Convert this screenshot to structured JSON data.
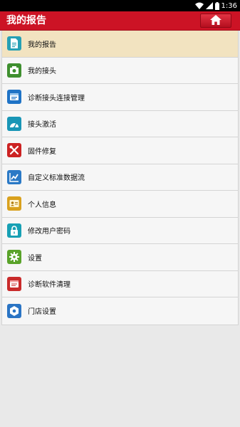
{
  "status_bar": {
    "time": "1:36"
  },
  "header": {
    "title": "我的报告",
    "home_icon": "home-icon"
  },
  "menu": {
    "items": [
      {
        "label": "我的报告",
        "icon": "report-icon",
        "color": "#25a0b5",
        "active": true
      },
      {
        "label": "我的接头",
        "icon": "connector-icon",
        "color": "#3f8f2f",
        "active": false
      },
      {
        "label": "诊断接头连接管理",
        "icon": "connection-manage-icon",
        "color": "#1f73c6",
        "active": false
      },
      {
        "label": "接头激活",
        "icon": "activate-icon",
        "color": "#1996b6",
        "active": false
      },
      {
        "label": "固件修复",
        "icon": "tools-icon",
        "color": "#cc2222",
        "active": false
      },
      {
        "label": "自定义标准数据流",
        "icon": "chart-icon",
        "color": "#2a79c6",
        "active": false
      },
      {
        "label": "个人信息",
        "icon": "id-card-icon",
        "color": "#d9a11e",
        "active": false
      },
      {
        "label": "修改用户密码",
        "icon": "lock-icon",
        "color": "#17a0b4",
        "active": false
      },
      {
        "label": "设置",
        "icon": "gear-icon",
        "color": "#5aa32a",
        "active": false
      },
      {
        "label": "诊断软件清理",
        "icon": "cleanup-icon",
        "color": "#c92b2b",
        "active": false
      },
      {
        "label": "门店设置",
        "icon": "store-settings-icon",
        "color": "#2a74c4",
        "active": false
      }
    ]
  }
}
